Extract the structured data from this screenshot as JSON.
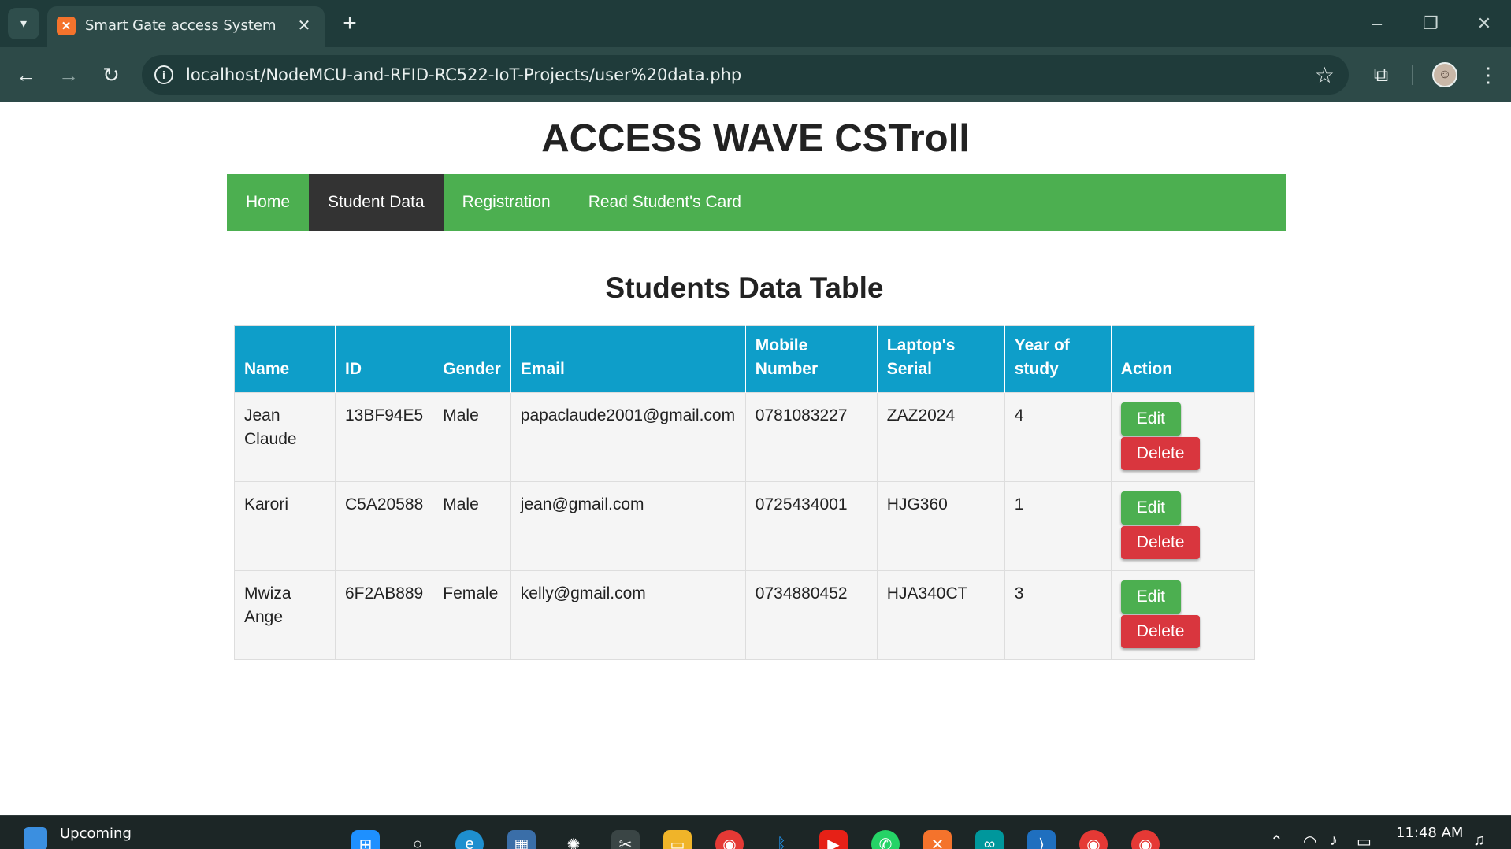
{
  "browser": {
    "tab_title": "Smart Gate access System",
    "tab_favicon": "xampp-icon",
    "url": "localhost/NodeMCU-and-RFID-RC522-IoT-Projects/user%20data.php",
    "icons": {
      "tab_menu": "chevron-down-icon",
      "tab_close": "close-icon",
      "new_tab": "plus-icon",
      "back": "back-arrow-icon",
      "forward": "forward-arrow-icon",
      "reload": "reload-icon",
      "site_info": "info-icon",
      "bookmark": "star-icon",
      "extensions": "puzzle-icon",
      "profile": "avatar-icon",
      "menu": "kebab-menu-icon"
    }
  },
  "page": {
    "site_title": "ACCESS WAVE CSTroll",
    "nav": [
      {
        "label": "Home",
        "active": false
      },
      {
        "label": "Student Data",
        "active": true
      },
      {
        "label": "Registration",
        "active": false
      },
      {
        "label": "Read Student's Card",
        "active": false
      }
    ],
    "table_title": "Students Data Table",
    "table": {
      "headers": {
        "name": "Name",
        "id": "ID",
        "gender": "Gender",
        "email": "Email",
        "mobile_1": "Mobile",
        "mobile_2": "Number",
        "laptop_1": "Laptop's",
        "laptop_2": "Serial",
        "year_1": "Year of",
        "year_2": "study",
        "action": "Action"
      },
      "rows": [
        {
          "name_1": "Jean",
          "name_2": "Claude",
          "id": "13BF94E5",
          "gender": "Male",
          "email": "papaclaude2001@gmail.com",
          "mobile": "0781083227",
          "laptop": "ZAZ2024",
          "year": "4",
          "edit": "Edit",
          "delete": "Delete"
        },
        {
          "name_1": "Karori",
          "name_2": "",
          "id": "C5A20588",
          "gender": "Male",
          "email": "jean@gmail.com",
          "mobile": "0725434001",
          "laptop": "HJG360",
          "year": "1",
          "edit": "Edit",
          "delete": "Delete"
        },
        {
          "name_1": "Mwiza",
          "name_2": "Ange",
          "id": "6F2AB889",
          "gender": "Female",
          "email": "kelly@gmail.com",
          "mobile": "0734880452",
          "laptop": "HJA340CT",
          "year": "3",
          "edit": "Edit",
          "delete": "Delete"
        }
      ]
    },
    "colors": {
      "nav_green": "#4caf50",
      "nav_active": "#333333",
      "table_header": "#0e9ec9",
      "edit_button": "#4caf50",
      "delete_button": "#d9363e"
    }
  },
  "taskbar": {
    "weather_label": "Upcoming",
    "time": "11:48 AM",
    "apps": [
      "windows-start-icon",
      "search-icon",
      "edge-icon",
      "store-icon",
      "app-icon",
      "snipping-icon",
      "file-explorer-icon",
      "chrome-icon",
      "bluetooth-icon",
      "youtube-icon",
      "whatsapp-icon",
      "xampp-icon",
      "arduino-icon",
      "vscode-icon",
      "chrome-profile-icon",
      "chrome-profile-icon"
    ]
  }
}
